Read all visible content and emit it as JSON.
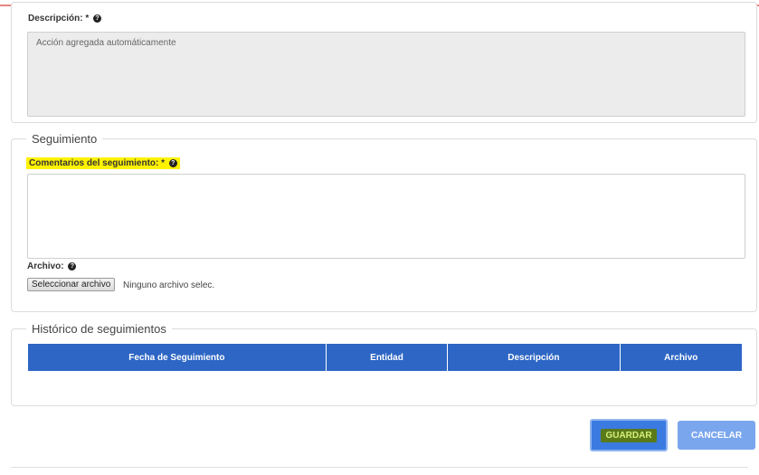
{
  "description": {
    "label": "Descripción: *",
    "value": "Acción agregada automáticamente"
  },
  "tracking": {
    "legend": "Seguimiento",
    "comments_label": "Comentarios del seguimiento: *",
    "file_label": "Archivo:",
    "file_button": "Seleccionar archivo",
    "file_status": "Ninguno archivo selec."
  },
  "history": {
    "legend": "Histórico de seguimientos",
    "columns": [
      "Fecha de Seguimiento",
      "Entidad",
      "Descripción",
      "Archivo"
    ]
  },
  "actions": {
    "save_label": "GUARDAR",
    "cancel_label": "CANCELAR"
  },
  "icons": {
    "help": "question-circle-icon"
  },
  "colors": {
    "primary": "#2d66c4",
    "highlight": "#fff200",
    "accent_line": "#d9534f"
  }
}
